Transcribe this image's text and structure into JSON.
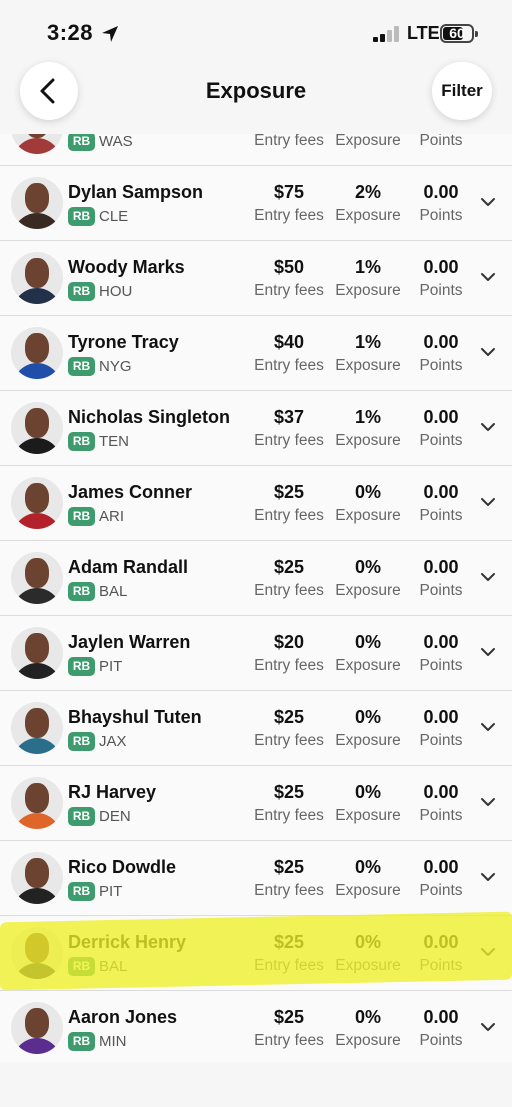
{
  "status_bar": {
    "time": "3:28",
    "network": "LTE",
    "battery": "60"
  },
  "header": {
    "title": "Exposure",
    "filter_label": "Filter"
  },
  "labels": {
    "fees": "Entry fees",
    "exposure": "Exposure",
    "points": "Points"
  },
  "colors": {
    "rb_badge": "#3e9b6e",
    "highlight": "#eef028"
  },
  "rows": [
    {
      "name": "",
      "position": "RB",
      "team": "WAS",
      "fee": "",
      "exposure": "",
      "points": "",
      "jersey": "#a33a3a"
    },
    {
      "name": "Dylan Sampson",
      "position": "RB",
      "team": "CLE",
      "fee": "$75",
      "exposure": "2%",
      "points": "0.00",
      "jersey": "#3a2b22"
    },
    {
      "name": "Woody Marks",
      "position": "RB",
      "team": "HOU",
      "fee": "$50",
      "exposure": "1%",
      "points": "0.00",
      "jersey": "#22304a"
    },
    {
      "name": "Tyrone Tracy",
      "position": "RB",
      "team": "NYG",
      "fee": "$40",
      "exposure": "1%",
      "points": "0.00",
      "jersey": "#1f4fa8"
    },
    {
      "name": "Nicholas Singleton",
      "position": "RB",
      "team": "TEN",
      "fee": "$37",
      "exposure": "1%",
      "points": "0.00",
      "jersey": "#1b1b1b"
    },
    {
      "name": "James Conner",
      "position": "RB",
      "team": "ARI",
      "fee": "$25",
      "exposure": "0%",
      "points": "0.00",
      "jersey": "#b3222b"
    },
    {
      "name": "Adam Randall",
      "position": "RB",
      "team": "BAL",
      "fee": "$25",
      "exposure": "0%",
      "points": "0.00",
      "jersey": "#2b2b2b"
    },
    {
      "name": "Jaylen Warren",
      "position": "RB",
      "team": "PIT",
      "fee": "$20",
      "exposure": "0%",
      "points": "0.00",
      "jersey": "#222222"
    },
    {
      "name": "Bhayshul Tuten",
      "position": "RB",
      "team": "JAX",
      "fee": "$25",
      "exposure": "0%",
      "points": "0.00",
      "jersey": "#2a6e8a"
    },
    {
      "name": "RJ Harvey",
      "position": "RB",
      "team": "DEN",
      "fee": "$25",
      "exposure": "0%",
      "points": "0.00",
      "jersey": "#e0652a"
    },
    {
      "name": "Rico Dowdle",
      "position": "RB",
      "team": "PIT",
      "fee": "$25",
      "exposure": "0%",
      "points": "0.00",
      "jersey": "#222222"
    },
    {
      "name": "Derrick Henry",
      "position": "RB",
      "team": "BAL",
      "fee": "$25",
      "exposure": "0%",
      "points": "0.00",
      "jersey": "#2d2a44"
    },
    {
      "name": "Aaron Jones",
      "position": "RB",
      "team": "MIN",
      "fee": "$25",
      "exposure": "0%",
      "points": "0.00",
      "jersey": "#5b2d8e"
    }
  ]
}
